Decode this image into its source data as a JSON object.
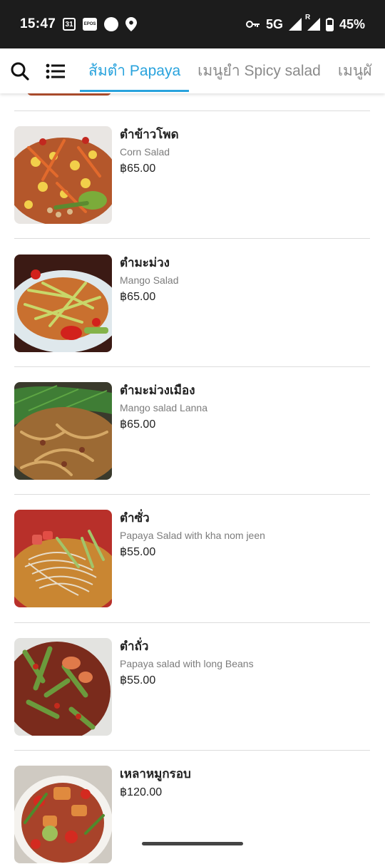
{
  "status_bar": {
    "time": "15:47",
    "calendar_day": "31",
    "epos_label": "EPOS",
    "network": "5G",
    "roaming": "R",
    "battery": "45%"
  },
  "header": {
    "tabs": [
      {
        "label": "ส้มตำ Papaya",
        "active": true
      },
      {
        "label": "เมนูยำ Spicy salad",
        "active": false
      },
      {
        "label": "เมนูผั",
        "active": false
      }
    ]
  },
  "menu_items": [
    {
      "name": "ตำข้าวโพด",
      "subtitle": "Corn Salad",
      "price": "฿65.00"
    },
    {
      "name": "ตำมะม่วง",
      "subtitle": "Mango Salad",
      "price": "฿65.00"
    },
    {
      "name": "ตำมะม่วงเมือง",
      "subtitle": "Mango salad Lanna",
      "price": "฿65.00"
    },
    {
      "name": "ตำซั่ว",
      "subtitle": "Papaya Salad with kha nom jeen",
      "price": "฿55.00"
    },
    {
      "name": "ตำถั่ว",
      "subtitle": "Papaya salad with long Beans",
      "price": "฿55.00"
    },
    {
      "name": "เหลาหมูกรอบ",
      "price": "฿120.00"
    }
  ],
  "colors": {
    "accent": "#29a3dd",
    "status_bar_bg": "#1c1c1c",
    "divider": "#dcdcdc"
  }
}
